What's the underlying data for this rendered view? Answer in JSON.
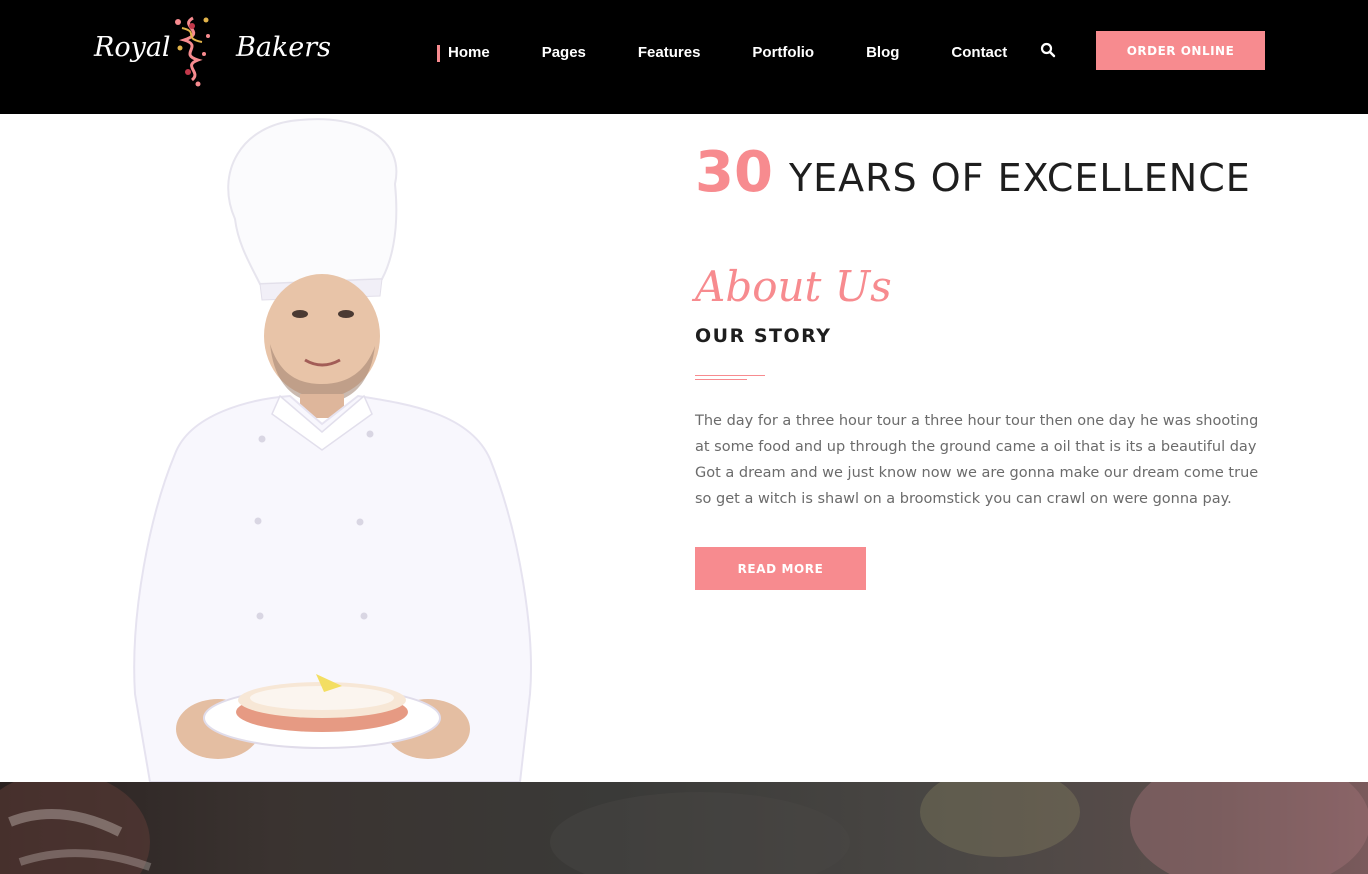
{
  "header": {
    "logo": {
      "left_word": "Royal",
      "right_word": "Bakers"
    },
    "nav": {
      "items": [
        {
          "label": "Home",
          "active": true
        },
        {
          "label": "Pages",
          "active": false
        },
        {
          "label": "Features",
          "active": false
        },
        {
          "label": "Portfolio",
          "active": false
        },
        {
          "label": "Blog",
          "active": false
        },
        {
          "label": "Contact",
          "active": false
        }
      ]
    },
    "search_icon": "search-icon",
    "order_button": "ORDER ONLINE"
  },
  "about": {
    "years_number": "30",
    "years_text": "YEARS OF EXCELLENCE",
    "script_title": "About Us",
    "subtitle": "OUR STORY",
    "paragraph": "The day for a three hour tour a three hour tour then one day he was shooting at some food and up through the ground came a oil that is its a beautiful day Got a dream and we just know now we are gonna make our dream come true so get a witch is shawl on a broomstick you can crawl on were gonna pay.",
    "read_more": "READ MORE"
  },
  "colors": {
    "accent": "#f78b8f",
    "header_bg": "#000000",
    "heading": "#1e1e1e",
    "body_text": "#6b6b6b"
  }
}
